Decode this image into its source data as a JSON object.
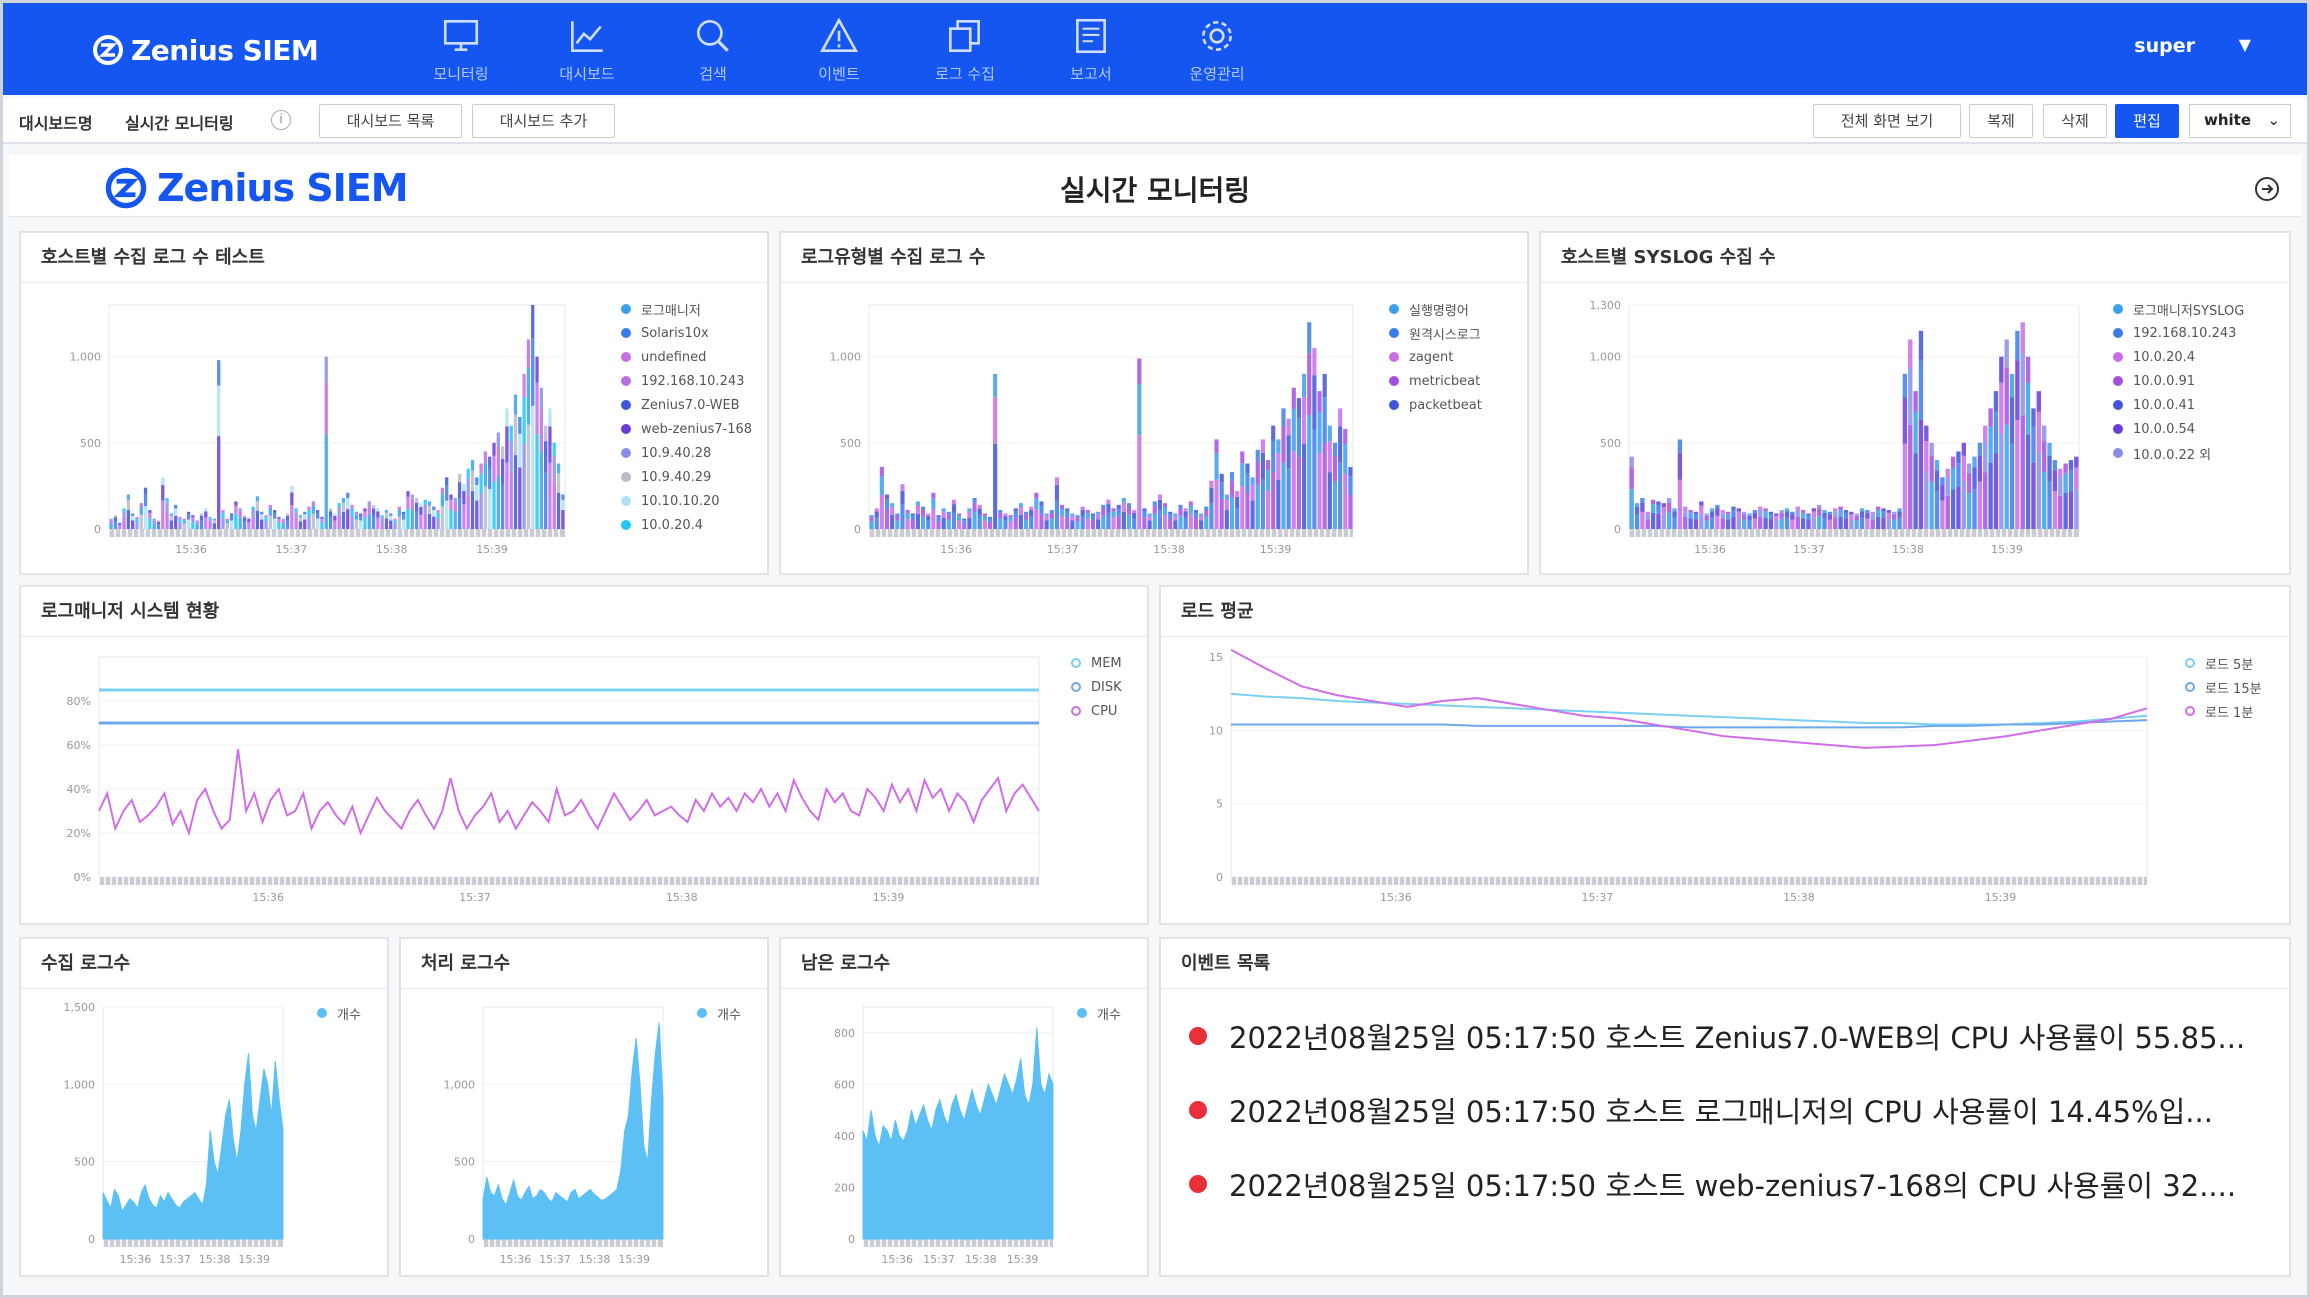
{
  "app": {
    "logo_text": "Zenius SIEM",
    "user": "super",
    "nav": [
      {
        "label": "모니터링",
        "icon": "monitor-icon"
      },
      {
        "label": "대시보드",
        "icon": "chart-line-icon"
      },
      {
        "label": "검색",
        "icon": "search-icon"
      },
      {
        "label": "이벤트",
        "icon": "alert-triangle-icon"
      },
      {
        "label": "로그 수집",
        "icon": "copy-stack-icon"
      },
      {
        "label": "보고서",
        "icon": "report-icon"
      },
      {
        "label": "운영관리",
        "icon": "gear-icon"
      }
    ]
  },
  "subbar": {
    "crumb1": "대시보드명",
    "crumb2": "실시간 모니터링",
    "info": "i",
    "btn_list": "대시보드 목록",
    "btn_add": "대시보드 추가",
    "btn_fullscreen": "전체 화면 보기",
    "btn_copy": "복제",
    "btn_delete": "삭제",
    "btn_edit": "편집",
    "theme_value": "white"
  },
  "dashboard": {
    "logo_text": "Zenius SIEM",
    "title": "실시간 모니터링"
  },
  "colors": {
    "brand": "#1656f0",
    "event_dot": "#e8303a"
  },
  "panels": {
    "p1_title": "호스트별 수집 로그 수 테스트",
    "p2_title": "로그유형별 수집 로그 수",
    "p3_title": "호스트별 SYSLOG 수집 수",
    "p4_title": "로그매니저 시스템 현황",
    "p5_title": "로드 평균",
    "p6_title": "수집 로그수",
    "p7_title": "처리 로그수",
    "p8_title": "남은 로그수",
    "p9_title": "이벤트 목록"
  },
  "chart_data": [
    {
      "id": "p1",
      "type": "bar",
      "ylim": [
        0,
        1300
      ],
      "yticks": [
        "0",
        "500",
        "1,000"
      ],
      "xticks": [
        "15:36",
        "15:37",
        "15:38",
        "15:39"
      ],
      "series": [
        {
          "name": "로그매니저",
          "color": "#3ba0ea"
        },
        {
          "name": "Solaris10x",
          "color": "#3b7cea"
        },
        {
          "name": "undefined",
          "color": "#c86ee6"
        },
        {
          "name": "192.168.10.243",
          "color": "#b86ee0"
        },
        {
          "name": "Zenius7.0-WEB",
          "color": "#3f54d8"
        },
        {
          "name": "web-zenius7-168",
          "color": "#6a3bd8"
        },
        {
          "name": "10.9.40.28",
          "color": "#8a8ee8"
        },
        {
          "name": "10.9.40.29",
          "color": "#b8bcc8"
        },
        {
          "name": "10.10.10.20",
          "color": "#aee0f8"
        },
        {
          "name": "10.0.20.4",
          "color": "#20c8f0"
        }
      ],
      "values": [
        60,
        80,
        40,
        120,
        200,
        90,
        70,
        150,
        240,
        110,
        60,
        50,
        300,
        180,
        90,
        140,
        70,
        60,
        100,
        80,
        50,
        90,
        120,
        70,
        60,
        980,
        110,
        60,
        90,
        160,
        120,
        80,
        70,
        130,
        190,
        100,
        80,
        140,
        110,
        70,
        60,
        90,
        250,
        120,
        80,
        100,
        130,
        160,
        110,
        70,
        1000,
        120,
        90,
        150,
        180,
        210,
        140,
        100,
        90,
        120,
        160,
        140,
        120,
        80,
        110,
        90,
        60,
        130,
        100,
        220,
        200,
        180,
        150,
        170,
        160,
        130,
        110,
        240,
        300,
        200,
        180,
        320,
        260,
        350,
        400,
        300,
        380,
        450,
        420,
        500,
        560,
        480,
        700,
        600,
        780,
        650,
        900,
        1100,
        1300,
        1000,
        820,
        600,
        700,
        500,
        380,
        200
      ]
    },
    {
      "id": "p2",
      "type": "bar",
      "ylim": [
        0,
        1300
      ],
      "yticks": [
        "0",
        "500",
        "1,000"
      ],
      "xticks": [
        "15:36",
        "15:37",
        "15:38",
        "15:39"
      ],
      "series": [
        {
          "name": "실행명령어",
          "color": "#3ba0ea"
        },
        {
          "name": "원격시스로그",
          "color": "#3b7cea"
        },
        {
          "name": "zagent",
          "color": "#c86ee6"
        },
        {
          "name": "metricbeat",
          "color": "#a64ee0"
        },
        {
          "name": "packetbeat",
          "color": "#3f54d8"
        }
      ],
      "values": [
        80,
        120,
        360,
        200,
        150,
        90,
        260,
        110,
        90,
        160,
        130,
        90,
        210,
        80,
        120,
        100,
        170,
        90,
        60,
        120,
        180,
        140,
        90,
        70,
        900,
        110,
        90,
        80,
        120,
        150,
        100,
        130,
        210,
        160,
        90,
        110,
        300,
        140,
        120,
        90,
        80,
        130,
        110,
        90,
        100,
        140,
        170,
        120,
        140,
        180,
        150,
        110,
        990,
        120,
        90,
        160,
        200,
        150,
        100,
        90,
        140,
        120,
        160,
        110,
        90,
        130,
        280,
        520,
        320,
        200,
        330,
        220,
        450,
        380,
        300,
        460,
        520,
        400,
        600,
        520,
        700,
        640,
        820,
        760,
        900,
        1200,
        1050,
        800,
        900,
        600,
        500,
        700,
        580,
        360
      ]
    },
    {
      "id": "p3",
      "type": "bar",
      "ylim": [
        0,
        1300
      ],
      "yticks": [
        "0",
        "500",
        "1,000",
        "1,300"
      ],
      "xticks": [
        "15:36",
        "15:37",
        "15:38",
        "15:39"
      ],
      "series": [
        {
          "name": "로그매니저SYSLOG",
          "color": "#3ba0ea"
        },
        {
          "name": "192.168.10.243",
          "color": "#3b7cea"
        },
        {
          "name": "10.0.20.4",
          "color": "#c86ee6"
        },
        {
          "name": "10.0.0.91",
          "color": "#a64ee0"
        },
        {
          "name": "10.0.0.41",
          "color": "#3f54d8"
        },
        {
          "name": "10.0.0.54",
          "color": "#6a3bd8"
        },
        {
          "name": "10.0.0.22 외",
          "color": "#8a8ee8"
        }
      ],
      "values": [
        420,
        150,
        180,
        100,
        170,
        160,
        150,
        180,
        120,
        520,
        130,
        110,
        100,
        160,
        90,
        120,
        140,
        110,
        100,
        130,
        120,
        100,
        90,
        110,
        130,
        120,
        100,
        90,
        110,
        120,
        100,
        130,
        110,
        90,
        120,
        140,
        110,
        100,
        120,
        130,
        110,
        100,
        90,
        120,
        110,
        100,
        130,
        120,
        110,
        100,
        120,
        900,
        1100,
        800,
        1150,
        600,
        500,
        400,
        300,
        350,
        420,
        450,
        500,
        380,
        420,
        500,
        600,
        700,
        800,
        1000,
        1100,
        900,
        1150,
        1200,
        1000,
        700,
        800,
        600,
        500,
        400,
        350,
        380,
        400,
        420
      ]
    },
    {
      "id": "p4",
      "type": "line",
      "ylim": [
        0,
        100
      ],
      "yticks": [
        "0%",
        "20%",
        "40%",
        "60%",
        "80%"
      ],
      "xticks": [
        "15:36",
        "15:37",
        "15:38",
        "15:39"
      ],
      "series": [
        {
          "name": "MEM",
          "color": "#79d0f2",
          "values": [
            85,
            85
          ]
        },
        {
          "name": "DISK",
          "color": "#6fa8ea",
          "values": [
            70,
            70
          ]
        },
        {
          "name": "CPU",
          "color": "#d06ee8",
          "values": [
            30,
            38,
            22,
            30,
            35,
            25,
            28,
            32,
            38,
            24,
            30,
            20,
            35,
            40,
            30,
            22,
            26,
            58,
            30,
            38,
            25,
            35,
            40,
            28,
            30,
            38,
            22,
            30,
            34,
            28,
            24,
            32,
            20,
            28,
            36,
            30,
            26,
            22,
            30,
            35,
            28,
            22,
            30,
            45,
            30,
            22,
            28,
            32,
            38,
            25,
            30,
            22,
            28,
            34,
            30,
            25,
            40,
            28,
            30,
            35,
            28,
            22,
            30,
            38,
            32,
            26,
            30,
            35,
            28,
            30,
            32,
            28,
            25,
            35,
            30,
            38,
            32,
            36,
            30,
            38,
            34,
            40,
            32,
            38,
            30,
            44,
            36,
            30,
            26,
            40,
            34,
            38,
            30,
            28,
            40,
            36,
            30,
            42,
            34,
            40,
            30,
            44,
            36,
            40,
            30,
            38,
            34,
            25,
            35,
            40,
            45,
            30,
            38,
            42,
            36,
            30
          ]
        }
      ]
    },
    {
      "id": "p5",
      "type": "line",
      "ylim": [
        0,
        15
      ],
      "yticks": [
        "0",
        "5",
        "10",
        "15"
      ],
      "xticks": [
        "15:36",
        "15:37",
        "15:38",
        "15:39"
      ],
      "series": [
        {
          "name": "로드 5분",
          "color": "#79d0f2",
          "values": [
            12.5,
            12.3,
            12.2,
            12.0,
            11.9,
            11.8,
            11.7,
            11.6,
            11.5,
            11.4,
            11.3,
            11.2,
            11.1,
            11.0,
            10.9,
            10.8,
            10.7,
            10.6,
            10.5,
            10.5,
            10.4,
            10.4,
            10.4,
            10.5,
            10.6,
            10.8,
            11.0
          ]
        },
        {
          "name": "로드 15분",
          "color": "#6fa8ea",
          "values": [
            10.4,
            10.4,
            10.4,
            10.4,
            10.4,
            10.4,
            10.4,
            10.3,
            10.3,
            10.3,
            10.3,
            10.3,
            10.3,
            10.2,
            10.2,
            10.2,
            10.2,
            10.2,
            10.2,
            10.2,
            10.3,
            10.3,
            10.4,
            10.4,
            10.5,
            10.6,
            10.7
          ]
        },
        {
          "name": "로드 1분",
          "color": "#d06ee8",
          "values": [
            15.5,
            14.2,
            13.0,
            12.4,
            12.0,
            11.6,
            12.0,
            12.2,
            11.8,
            11.4,
            11.0,
            10.8,
            10.4,
            10.0,
            9.6,
            9.4,
            9.2,
            9.0,
            8.8,
            8.9,
            9.0,
            9.3,
            9.6,
            10.0,
            10.4,
            10.8,
            11.5
          ]
        }
      ]
    },
    {
      "id": "p6",
      "type": "area",
      "ylim": [
        0,
        1500
      ],
      "yticks": [
        "0",
        "500",
        "1,000",
        "1,500"
      ],
      "xticks": [
        "15:36",
        "15:37",
        "15:38",
        "15:39"
      ],
      "series": [
        {
          "name": "개수",
          "color": "#5cc0f4",
          "values": [
            300,
            250,
            200,
            320,
            280,
            180,
            220,
            260,
            240,
            200,
            300,
            350,
            260,
            220,
            200,
            280,
            240,
            300,
            260,
            220,
            200,
            240,
            260,
            280,
            300,
            260,
            220,
            350,
            700,
            500,
            420,
            600,
            800,
            900,
            650,
            500,
            700,
            1000,
            1200,
            800,
            700,
            900,
            1100,
            1000,
            800,
            1150,
            900,
            700
          ]
        }
      ]
    },
    {
      "id": "p7",
      "type": "area",
      "ylim": [
        0,
        1500
      ],
      "yticks": [
        "0",
        "500",
        "1,000"
      ],
      "xticks": [
        "15:36",
        "15:37",
        "15:38",
        "15:39"
      ],
      "series": [
        {
          "name": "개수",
          "color": "#5cc0f4",
          "values": [
            250,
            400,
            300,
            280,
            350,
            260,
            220,
            300,
            380,
            280,
            250,
            300,
            340,
            260,
            280,
            320,
            300,
            260,
            240,
            300,
            280,
            260,
            240,
            300,
            320,
            260,
            280,
            300,
            320,
            290,
            270,
            250,
            260,
            280,
            300,
            320,
            450,
            700,
            800,
            1100,
            1300,
            1000,
            600,
            500,
            900,
            1200,
            1400,
            900
          ]
        }
      ]
    },
    {
      "id": "p8",
      "type": "area",
      "ylim": [
        0,
        900
      ],
      "yticks": [
        "0",
        "200",
        "400",
        "600",
        "800"
      ],
      "xticks": [
        "15:36",
        "15:37",
        "15:38",
        "15:39"
      ],
      "series": [
        {
          "name": "개수",
          "color": "#5cc0f4",
          "values": [
            420,
            380,
            500,
            400,
            360,
            440,
            420,
            380,
            460,
            400,
            380,
            420,
            500,
            440,
            480,
            520,
            460,
            420,
            500,
            540,
            480,
            440,
            520,
            560,
            500,
            460,
            520,
            580,
            520,
            480,
            540,
            600,
            560,
            520,
            580,
            640,
            600,
            560,
            620,
            700,
            560,
            520,
            600,
            820,
            600,
            560,
            640,
            600
          ]
        }
      ]
    }
  ],
  "events": [
    {
      "text": "2022년08월25일 05:17:50 호스트 Zenius7.0-WEB의 CPU 사용률이 55.85..."
    },
    {
      "text": "2022년08월25일 05:17:50 호스트 로그매니저의 CPU 사용률이 14.45%입..."
    },
    {
      "text": "2022년08월25일 05:17:50 호스트 web-zenius7-168의 CPU 사용률이 32...."
    }
  ]
}
